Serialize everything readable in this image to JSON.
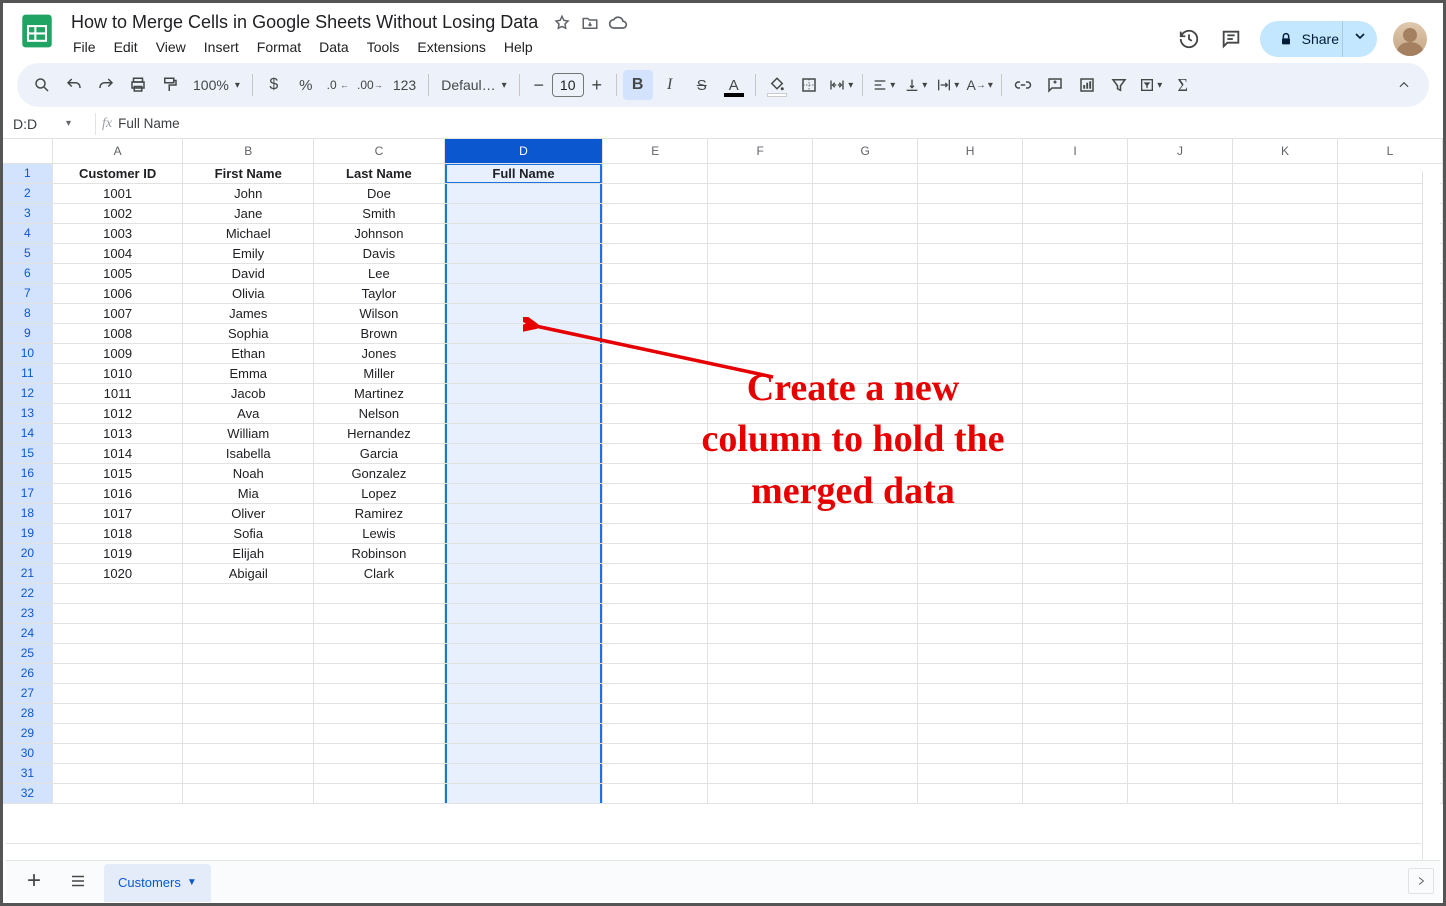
{
  "doc": {
    "title": "How to Merge Cells in Google Sheets Without Losing Data"
  },
  "menus": [
    "File",
    "Edit",
    "View",
    "Insert",
    "Format",
    "Data",
    "Tools",
    "Extensions",
    "Help"
  ],
  "share_label": "Share",
  "toolbar": {
    "zoom": "100%",
    "font": "Defaul…",
    "font_size": "10",
    "number_format": "123"
  },
  "name_box": "D:D",
  "formula_value": "Full Name",
  "columns": [
    "A",
    "B",
    "C",
    "D",
    "E",
    "F",
    "G",
    "H",
    "I",
    "J",
    "K",
    "L"
  ],
  "selected_column_index": 3,
  "headers": [
    "Customer ID",
    "First Name",
    "Last Name",
    "Full Name"
  ],
  "rows": [
    [
      "1001",
      "John",
      "Doe",
      ""
    ],
    [
      "1002",
      "Jane",
      "Smith",
      ""
    ],
    [
      "1003",
      "Michael",
      "Johnson",
      ""
    ],
    [
      "1004",
      "Emily",
      "Davis",
      ""
    ],
    [
      "1005",
      "David",
      "Lee",
      ""
    ],
    [
      "1006",
      "Olivia",
      "Taylor",
      ""
    ],
    [
      "1007",
      "James",
      "Wilson",
      ""
    ],
    [
      "1008",
      "Sophia",
      "Brown",
      ""
    ],
    [
      "1009",
      "Ethan",
      "Jones",
      ""
    ],
    [
      "1010",
      "Emma",
      "Miller",
      ""
    ],
    [
      "1011",
      "Jacob",
      "Martinez",
      ""
    ],
    [
      "1012",
      "Ava",
      "Nelson",
      ""
    ],
    [
      "1013",
      "William",
      "Hernandez",
      ""
    ],
    [
      "1014",
      "Isabella",
      "Garcia",
      ""
    ],
    [
      "1015",
      "Noah",
      "Gonzalez",
      ""
    ],
    [
      "1016",
      "Mia",
      "Lopez",
      ""
    ],
    [
      "1017",
      "Oliver",
      "Ramirez",
      ""
    ],
    [
      "1018",
      "Sofia",
      "Lewis",
      ""
    ],
    [
      "1019",
      "Elijah",
      "Robinson",
      ""
    ],
    [
      "1020",
      "Abigail",
      "Clark",
      ""
    ]
  ],
  "total_display_rows": 32,
  "sheet_tab": "Customers",
  "annotation": {
    "line1": "Create a new",
    "line2": "column to hold the",
    "line3": "merged data"
  }
}
